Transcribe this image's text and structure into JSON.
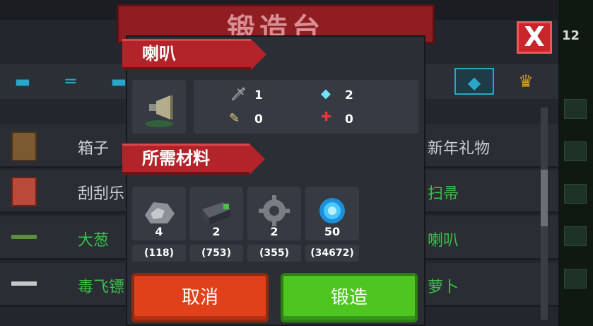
{
  "screen": {
    "title": "锻造台",
    "close_label": "X",
    "counter": "12"
  },
  "tabs": [
    {
      "icon": "pistol-icon"
    },
    {
      "icon": "rifle-icon"
    },
    {
      "icon": "smg-icon"
    },
    {
      "icon": "fish-weapon-icon",
      "active": true
    },
    {
      "icon": "crown-icon"
    }
  ],
  "list": {
    "left": [
      "箱子",
      "刮刮乐",
      "大葱",
      "毒飞镖"
    ],
    "right": [
      "新年礼物",
      "扫帚",
      "喇叭",
      "萝卜"
    ]
  },
  "dialog": {
    "item_name": "喇叭",
    "item_icon": "horn-icon",
    "stats": {
      "damage": "1",
      "energy": "2",
      "crit": "0",
      "accuracy": "0"
    },
    "materials_title": "所需材料",
    "materials": [
      {
        "icon": "ore-icon",
        "qty": "4",
        "stock": "(118)"
      },
      {
        "icon": "battery-icon",
        "qty": "2",
        "stock": "(753)"
      },
      {
        "icon": "gear-icon",
        "qty": "2",
        "stock": "(355)"
      },
      {
        "icon": "gem-coin-icon",
        "qty": "50",
        "stock": "(34672)"
      }
    ],
    "cancel_label": "取消",
    "forge_label": "锻造"
  },
  "colors": {
    "ribbon": "#b3242a",
    "cancel": "#e0401a",
    "forge": "#4fc520",
    "accent": "#2aa6c9"
  }
}
